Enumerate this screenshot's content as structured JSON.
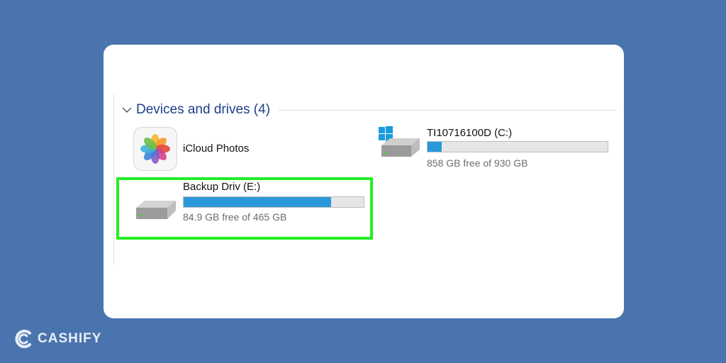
{
  "explorer": {
    "section_title": "Devices and drives (4)",
    "devices": [
      {
        "name": "iCloud Photos",
        "icon": "icloud-photos-icon"
      },
      {
        "name": "TI10716100D (C:)",
        "icon": "windows-drive-icon",
        "free_text": "858 GB free of 930 GB",
        "used_fraction": 0.08
      },
      {
        "name": "Backup Driv (E:)",
        "icon": "drive-icon",
        "free_text": "84.9 GB free of 465 GB",
        "used_fraction": 0.82,
        "highlighted": true
      }
    ]
  },
  "branding": {
    "logo_text": "CASHIFY"
  },
  "colors": {
    "background": "#4a74ae",
    "highlight": "#22ee22",
    "bar_fill": "#2b98d9",
    "section_title": "#1e3f8a"
  }
}
